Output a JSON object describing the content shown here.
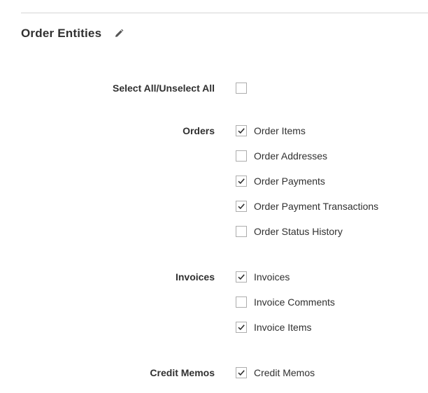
{
  "section": {
    "title": "Order Entities",
    "edit_icon": "pencil-icon"
  },
  "select_all": {
    "label": "Select All/Unselect All",
    "checked": false
  },
  "groups": [
    {
      "label": "Orders",
      "options": [
        {
          "label": "Order Items",
          "checked": true
        },
        {
          "label": "Order Addresses",
          "checked": false
        },
        {
          "label": "Order Payments",
          "checked": true
        },
        {
          "label": "Order Payment Transactions",
          "checked": true
        },
        {
          "label": "Order Status History",
          "checked": false
        }
      ]
    },
    {
      "label": "Invoices",
      "options": [
        {
          "label": "Invoices",
          "checked": true
        },
        {
          "label": "Invoice Comments",
          "checked": false
        },
        {
          "label": "Invoice Items",
          "checked": true
        }
      ]
    },
    {
      "label": "Credit Memos",
      "options": [
        {
          "label": "Credit Memos",
          "checked": true
        }
      ]
    }
  ],
  "colors": {
    "text": "#303030",
    "checkbox_border": "#adadad",
    "divider": "#d6d6d6"
  }
}
